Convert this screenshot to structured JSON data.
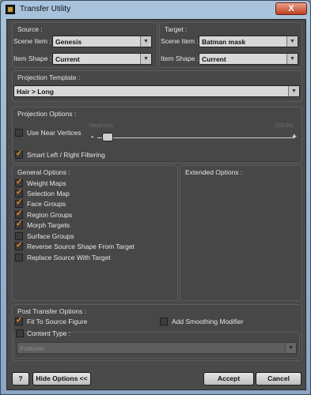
{
  "window": {
    "title": "Transfer Utility",
    "close_symbol": "X"
  },
  "source": {
    "title": "Source :",
    "scene_item_label": "Scene Item :",
    "scene_item_value": "Genesis",
    "item_shape_label": "Item Shape :",
    "item_shape_value": "Current"
  },
  "target": {
    "title": "Target :",
    "scene_item_label": "Scene Item :",
    "scene_item_value": "Batman mask",
    "item_shape_label": "Item Shape :",
    "item_shape_value": "Current"
  },
  "projection_template": {
    "title": "Projection Template :",
    "value": "Hair > Long"
  },
  "projection_options": {
    "title": "Projection Options :",
    "use_near_vertices": {
      "label": "Use Near Vertices",
      "checked": false
    },
    "slider": {
      "min_label": "Nearness",
      "max_label": "150.0%",
      "minus": "-",
      "plus": "+"
    },
    "smart_filtering": {
      "label": "Smart Left / Right Filtering",
      "checked": true
    }
  },
  "general_options": {
    "title": "General Options :",
    "items": [
      {
        "label": "Weight Maps",
        "checked": true
      },
      {
        "label": "Selection Map",
        "checked": true
      },
      {
        "label": "Face Groups",
        "checked": true
      },
      {
        "label": "Region Groups",
        "checked": true
      },
      {
        "label": "Morph Targets",
        "checked": true
      },
      {
        "label": "Surface Groups",
        "checked": false
      },
      {
        "label": "Reverse Source Shape From Target",
        "checked": true
      },
      {
        "label": "Replace Source With Target",
        "checked": false
      }
    ]
  },
  "extended_options": {
    "title": "Extended Options :"
  },
  "post_transfer": {
    "title": "Post Transfer Options :",
    "fit_to_source": {
      "label": "Fit To Source Figure",
      "checked": true
    },
    "add_smoothing": {
      "label": "Add Smoothing Modifier",
      "checked": false
    },
    "content_type": {
      "label": "Content Type :",
      "checked": false,
      "value": "Follower"
    }
  },
  "buttons": {
    "help": "?",
    "hide_options": "Hide Options <<",
    "accept": "Accept",
    "cancel": "Cancel"
  },
  "colors": {
    "accent_check": "#f08a1a",
    "panel_bg": "#474747",
    "window_bg": "#4a4a4a"
  }
}
